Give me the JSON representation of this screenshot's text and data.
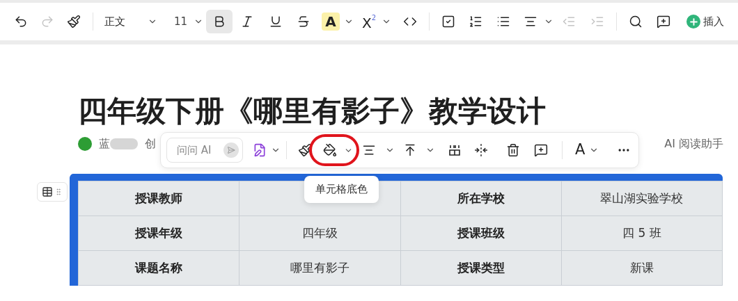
{
  "toolbar": {
    "undo_disabled": false,
    "redo_disabled": true,
    "paragraph_style": "正文",
    "font_size": "11",
    "bold_selected": true,
    "highlight_letter": "A",
    "superscript_base": "X",
    "superscript_mark": "2",
    "outdent_disabled": true,
    "indent_disabled": true,
    "insert_label": "插入"
  },
  "document": {
    "title": "四年级下册《哪里有影子》教学设计",
    "author_initial": "蓝",
    "author_redacted": true,
    "meta_partial": "创",
    "reading_assistant": "AI 阅读助手"
  },
  "floating_toolbar": {
    "ask_placeholder": "问问 AI",
    "cell_fill_ring": true,
    "font_letter": "A",
    "tooltip": "单元格底色"
  },
  "table": {
    "selected": true,
    "rows": [
      [
        {
          "text": "授课教师",
          "header": true
        },
        {},
        {
          "text": "所在学校",
          "header": true
        },
        {
          "text": "翠山湖实验学校",
          "header": false
        }
      ],
      [
        {
          "text": "授课年级",
          "header": true
        },
        {
          "text": "四年级",
          "header": false
        },
        {
          "text": "授课班级",
          "header": true
        },
        {
          "text": "四 5 班",
          "header": false
        }
      ],
      [
        {
          "text": "课题名称",
          "header": true
        },
        {
          "text": "哪里有影子",
          "header": false
        },
        {
          "text": "授课类型",
          "header": true
        },
        {
          "text": "新课",
          "header": false
        }
      ]
    ]
  }
}
